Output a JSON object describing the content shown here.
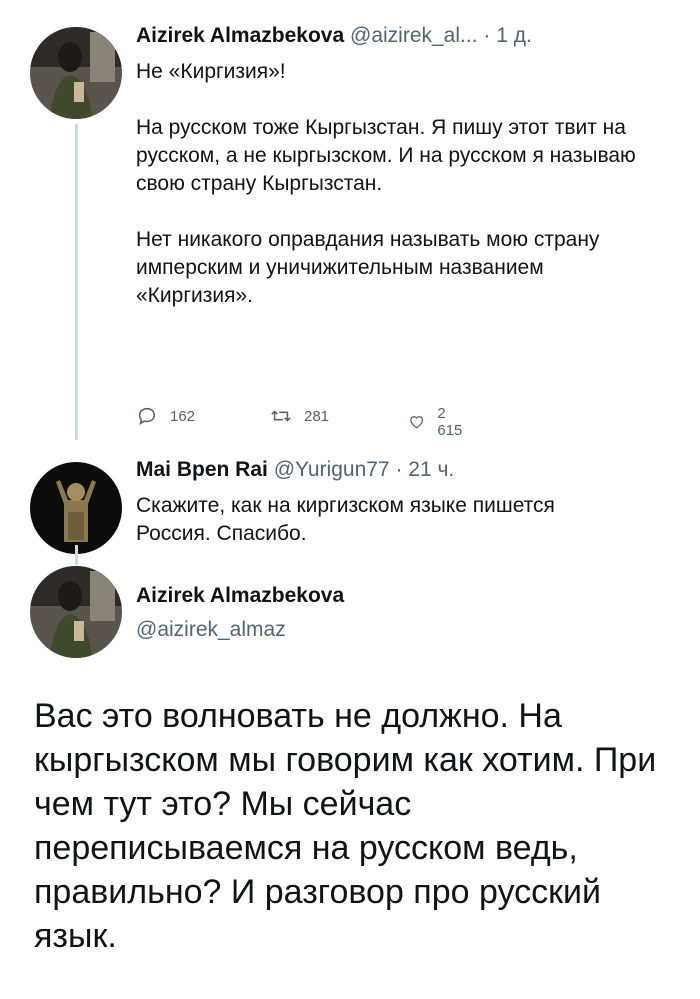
{
  "tweet1": {
    "name": "Aizirek Almazbekova",
    "meta": "@aizirek_al... · 1 д.",
    "lines": [
      "Не «Киргизия»!",
      "На русском тоже Кыргызстан. Я пишу этот твит на русском, а не кыргызском. И на русском я называю свою страну Кыргызстан.",
      "Нет никакого оправдания называть мою страну имперским и уничижительным названием «Киргизия»."
    ],
    "replies": "162",
    "retweets": "281",
    "likes": "2 615"
  },
  "tweet2": {
    "name": "Mai Bpen Rai",
    "meta": "@Yurigun77 · 21 ч.",
    "text": "Скажите, как на киргизском языке пишется Россия. Спасибо."
  },
  "tweet3": {
    "name": "Aizirek Almazbekova",
    "handle": "@aizirek_almaz",
    "text": "Вас это волновать не должно. На кыргызском мы говорим как хотим. При чем тут это? Мы сейчас переписываемся на русском ведь, правильно? И разговор про русский язык."
  },
  "icons": {
    "reply": "reply-icon",
    "retweet": "retweet-icon",
    "like": "like-icon"
  },
  "colors": {
    "text": "#0f1419",
    "secondary": "#536471",
    "thread_line": "#cfd9de"
  }
}
